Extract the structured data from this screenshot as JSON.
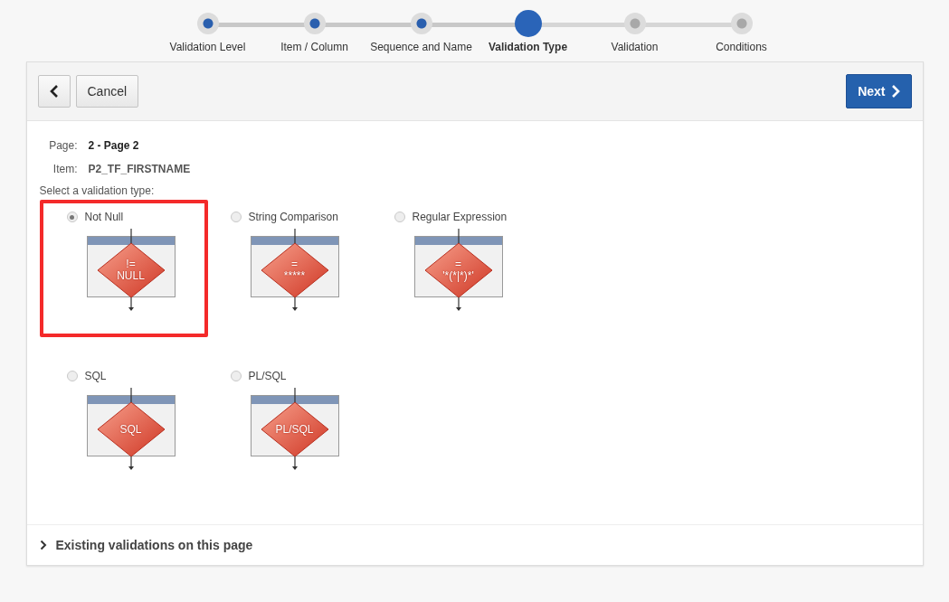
{
  "wizard": {
    "steps": [
      {
        "label": "Validation Level",
        "completed": true,
        "selected": false
      },
      {
        "label": "Item / Column",
        "completed": true,
        "selected": false
      },
      {
        "label": "Sequence and Name",
        "completed": true,
        "selected": false
      },
      {
        "label": "Validation Type",
        "completed": true,
        "selected": true
      },
      {
        "label": "Validation",
        "completed": false,
        "selected": false
      },
      {
        "label": "Conditions",
        "completed": false,
        "selected": false
      }
    ]
  },
  "toolbar": {
    "cancel": "Cancel",
    "next": "Next"
  },
  "fields": [
    {
      "label": "Page:",
      "value": "2 - Page 2"
    },
    {
      "label": "Item:",
      "value": "P2_TF_FIRSTNAME"
    }
  ],
  "prompt": "Select a validation type:",
  "options": [
    {
      "label": "Not Null",
      "selected": true,
      "highlighted": true,
      "symbol_lines": [
        "!=",
        "NULL"
      ]
    },
    {
      "label": "String Comparison",
      "selected": false,
      "highlighted": false,
      "symbol_lines": [
        "=",
        "*****"
      ]
    },
    {
      "label": "Regular Expression",
      "selected": false,
      "highlighted": false,
      "symbol_lines": [
        "=",
        "'*(*|*)*'"
      ]
    },
    {
      "label": "SQL",
      "selected": false,
      "highlighted": false,
      "symbol_lines": [
        "SQL"
      ]
    },
    {
      "label": "PL/SQL",
      "selected": false,
      "highlighted": false,
      "symbol_lines": [
        "PL/SQL"
      ]
    }
  ],
  "existing": {
    "label": "Existing validations on this page",
    "expanded": false
  }
}
